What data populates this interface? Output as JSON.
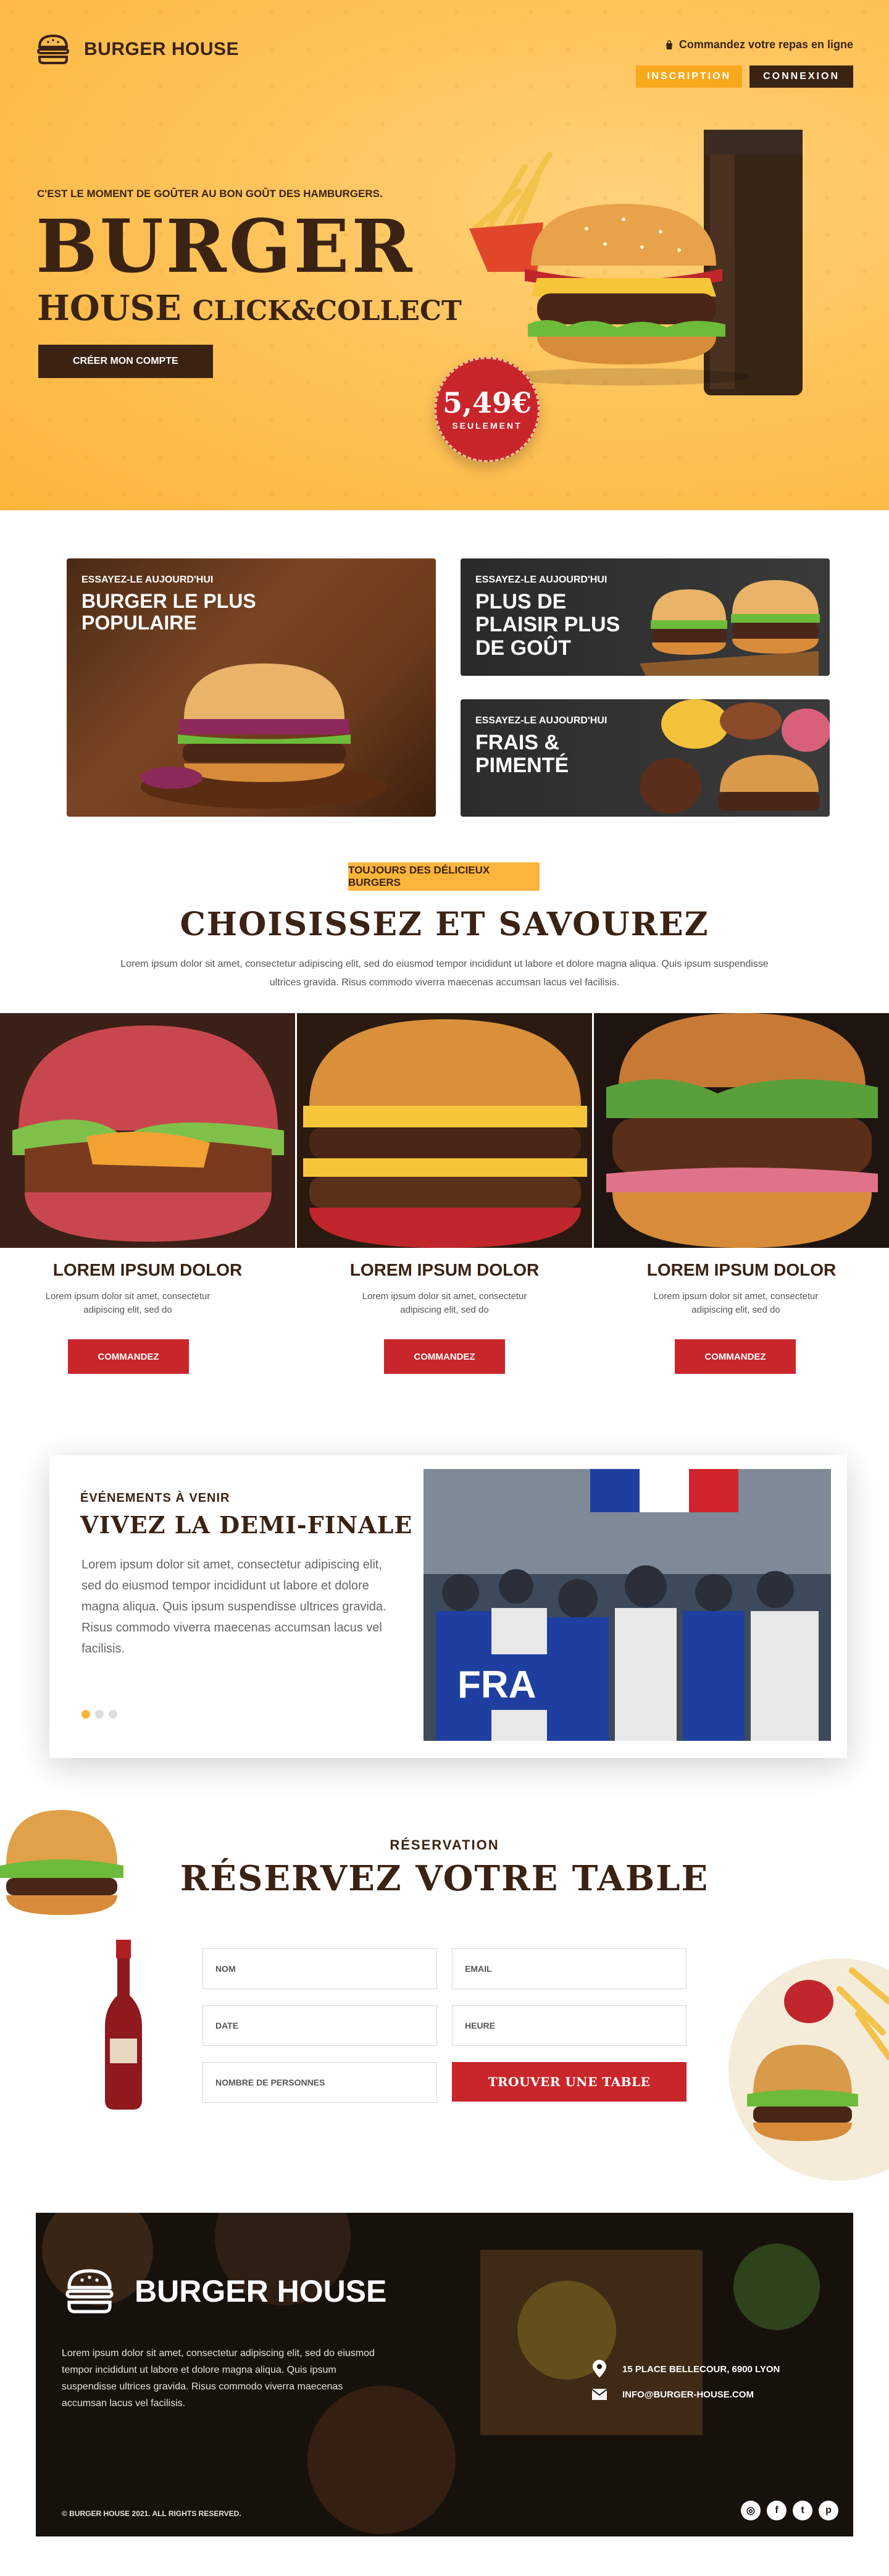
{
  "brand": {
    "name": "BURGER HOUSE"
  },
  "header": {
    "order_online": "Commandez votre repas en ligne",
    "inscription": "INSCRIPTION",
    "connexion": "CONNEXION"
  },
  "hero": {
    "eyebrow": "C'EST LE MOMENT DE GOÛTER AU BON GOÛT DES HAMBURGERS.",
    "title": "BURGER",
    "sub_a": "HOUSE",
    "sub_b": "CLICK&COLLECT",
    "cta": "CRÉER MON COMPTE",
    "price": "5,49€",
    "price_label": "SEULEMENT"
  },
  "promos": [
    {
      "eyebrow": "ESSAYEZ-LE AUJOURD'HUI",
      "title": "BURGER LE PLUS POPULAIRE"
    },
    {
      "eyebrow": "ESSAYEZ-LE AUJOURD'HUI",
      "title": "PLUS DE PLAISIR PLUS DE GOÛT"
    },
    {
      "eyebrow": "ESSAYEZ-LE AUJOURD'HUI",
      "title": "FRAIS & PIMENTÉ"
    }
  ],
  "choose": {
    "pill": "TOUJOURS DES DÉLICIEUX BURGERS",
    "title": "CHOISISSEZ ET SAVOUREZ",
    "text": "Lorem ipsum dolor sit amet, consectetur adipiscing elit, sed do eiusmod tempor incididunt ut labore et dolore magna aliqua. Quis ipsum suspendisse ultrices gravida. Risus commodo viverra maecenas accumsan lacus vel facilisis."
  },
  "products": [
    {
      "name": "LOREM IPSUM DOLOR",
      "desc": "Lorem ipsum dolor sit amet, consectetur adipiscing elit, sed do",
      "button": "COMMANDEZ"
    },
    {
      "name": "LOREM IPSUM DOLOR",
      "desc": "Lorem ipsum dolor sit amet, consectetur adipiscing elit, sed do",
      "button": "COMMANDEZ"
    },
    {
      "name": "LOREM IPSUM DOLOR",
      "desc": "Lorem ipsum dolor sit amet, consectetur adipiscing elit, sed do",
      "button": "COMMANDEZ"
    }
  ],
  "event": {
    "eyebrow": "ÉVÉNEMENTS À VENIR",
    "title": "VIVEZ LA DEMI-FINALE",
    "text": "Lorem ipsum dolor sit amet, consectetur adipiscing elit, sed do eiusmod tempor incididunt ut labore et dolore magna aliqua. Quis ipsum suspendisse ultrices gravida. Risus commodo viverra maecenas accumsan lacus vel facilisis.",
    "banner_text": "FRA"
  },
  "reservation": {
    "eyebrow": "RÉSERVATION",
    "title": "RÉSERVEZ VOTRE TABLE",
    "nom": "NOM",
    "email": "EMAIL",
    "date": "DATE",
    "heure": "HEURE",
    "personnes": "NOMBRE DE PERSONNES",
    "submit": "TROUVER UNE TABLE"
  },
  "footer": {
    "text": "Lorem ipsum dolor sit amet, consectetur adipiscing elit, sed do eiusmod tempor incididunt ut labore et dolore magna aliqua. Quis ipsum suspendisse ultrices gravida. Risus commodo viverra maecenas accumsan lacus vel facilisis.",
    "address": "15 PLACE BELLECOUR, 6900 LYON",
    "email": "INFO@BURGER-HOUSE.COM",
    "copyright": "© BURGER HOUSE 2021. ALL RIGHTS RESERVED.",
    "socials": [
      "instagram",
      "facebook",
      "twitter",
      "pinterest"
    ]
  },
  "colors": {
    "yellow": "#fbb53c",
    "brown": "#3b2314",
    "red": "#c8262b"
  }
}
